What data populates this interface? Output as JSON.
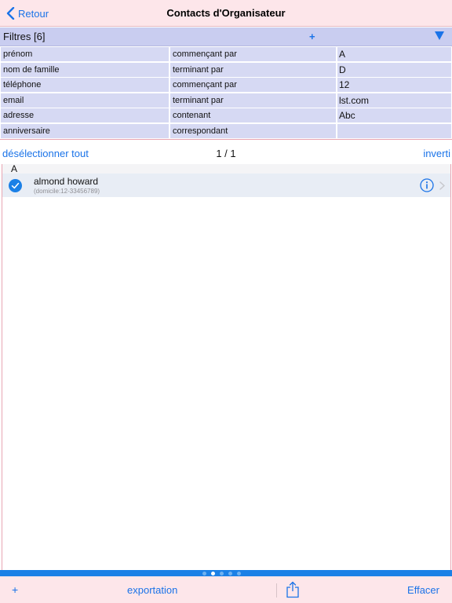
{
  "nav": {
    "back_label": "Retour",
    "title": "Contacts d'Organisateur"
  },
  "filters": {
    "title": "Filtres [6]",
    "add_label": "+",
    "rows": [
      {
        "field": "prénom",
        "operator": "commençant par",
        "value": "A"
      },
      {
        "field": "nom de famille",
        "operator": "terminant par",
        "value": "D"
      },
      {
        "field": "téléphone",
        "operator": "commençant par",
        "value": "12"
      },
      {
        "field": "email",
        "operator": "terminant par",
        "value": "lst.com"
      },
      {
        "field": "adresse",
        "operator": "contenant",
        "value": "Abc"
      },
      {
        "field": "anniversaire",
        "operator": "correspondant",
        "value": ""
      }
    ]
  },
  "selection": {
    "deselect_label": "désélectionner tout",
    "page_counter": "1 / 1",
    "invert_label": "inverti"
  },
  "contacts": {
    "section": "A",
    "items": [
      {
        "name": "almond howard",
        "detail": "(domicile:12-33456789)",
        "selected": true
      }
    ]
  },
  "pager": {
    "count": 5,
    "active": 1
  },
  "toolbar": {
    "add_label": "+",
    "export_label": "exportation",
    "clear_label": "Effacer"
  },
  "icons": {
    "back": "chevron-left-icon",
    "filters_toggle": "triangle-down-icon",
    "check": "checkmark-circle-icon",
    "info": "info-circle-icon",
    "chevron": "chevron-right-icon",
    "share": "share-icon"
  },
  "colors": {
    "accent": "#1a73e8",
    "bar_background": "#fde6ea",
    "filter_header": "#c9cdf0",
    "filter_cell": "#d6d9f3",
    "page_bar": "#1b80e6"
  }
}
